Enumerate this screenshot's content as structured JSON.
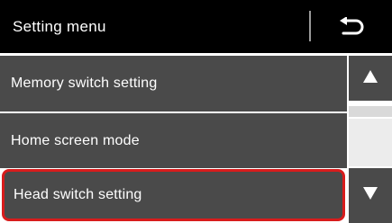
{
  "header": {
    "title": "Setting menu",
    "back_icon": "return-arrow-icon"
  },
  "menu": {
    "items": [
      {
        "label": "Memory switch setting",
        "selected": false
      },
      {
        "label": "Home screen mode",
        "selected": false
      },
      {
        "label": "Head switch setting",
        "selected": true
      }
    ]
  },
  "scrollbar": {
    "up_icon": "triangle-up-icon",
    "down_icon": "triangle-down-icon"
  },
  "colors": {
    "header_bg": "#000000",
    "item_bg": "#4a4a4a",
    "highlight": "#d81c1c",
    "text": "#ffffff"
  }
}
